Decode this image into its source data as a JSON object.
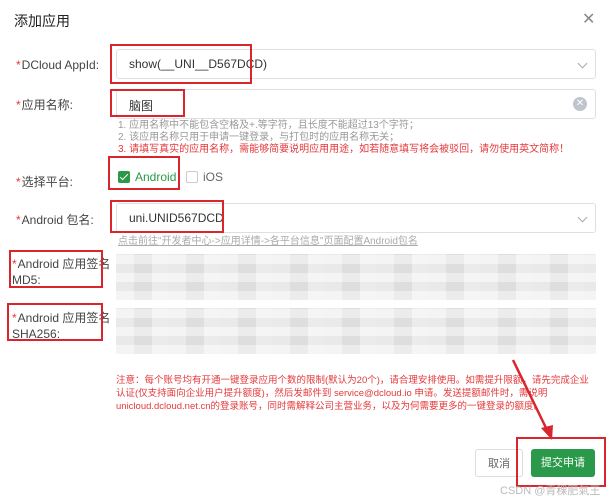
{
  "dialog": {
    "title": "添加应用",
    "close_glyph": "✕"
  },
  "form": {
    "appid": {
      "label": "DCloud AppId:",
      "value": "show(__UNI__D567DCD)"
    },
    "app_name": {
      "label": "应用名称:",
      "value": "脑图",
      "clear_glyph": "✕",
      "hints": [
        "1. 应用名称中不能包含空格及+.等字符，且长度不能超过13个字符；",
        "2. 该应用名称只用于申请一键登录，与打包时的应用名称无关；"
      ],
      "warning": "3. 请填写真实的应用名称，需能够简要说明应用用途，如若随意填写将会被驳回，请勿使用英文简称！"
    },
    "platform": {
      "label": "选择平台:",
      "options": [
        {
          "label": "Android",
          "checked": true
        },
        {
          "label": "iOS",
          "checked": false
        }
      ]
    },
    "package": {
      "label": "Android 包名:",
      "value": "uni.UNID567DCD",
      "link_hint": "点击前往\"开发者中心->应用详情->各平台信息\"页面配置Android包名"
    },
    "md5": {
      "label_line1": "Android 应用签名",
      "label_line2": "MD5:"
    },
    "sha256": {
      "label_line1": "Android 应用签名",
      "label_line2": "SHA256:"
    }
  },
  "note": "注意：每个账号均有开通一键登录应用个数的限制(默认为20个)，请合理安排使用。如需提升限额，请先完成企业认证(仅支持面向企业用户提升额度)，然后发邮件到 service@dcloud.io 申请。发送提额邮件时，需说明unicloud.dcloud.net.cn的登录账号，同时需解释公司主营业务，以及为何需要更多的一键登录的额度。",
  "footer": {
    "cancel_label": "取消",
    "submit_label": "提交申请"
  },
  "watermark": "CSDN @青稞肥氣王",
  "colors": {
    "accent_green": "#2a9a4a",
    "highlight_red": "#d9262c",
    "warning_red": "#e4393c"
  }
}
